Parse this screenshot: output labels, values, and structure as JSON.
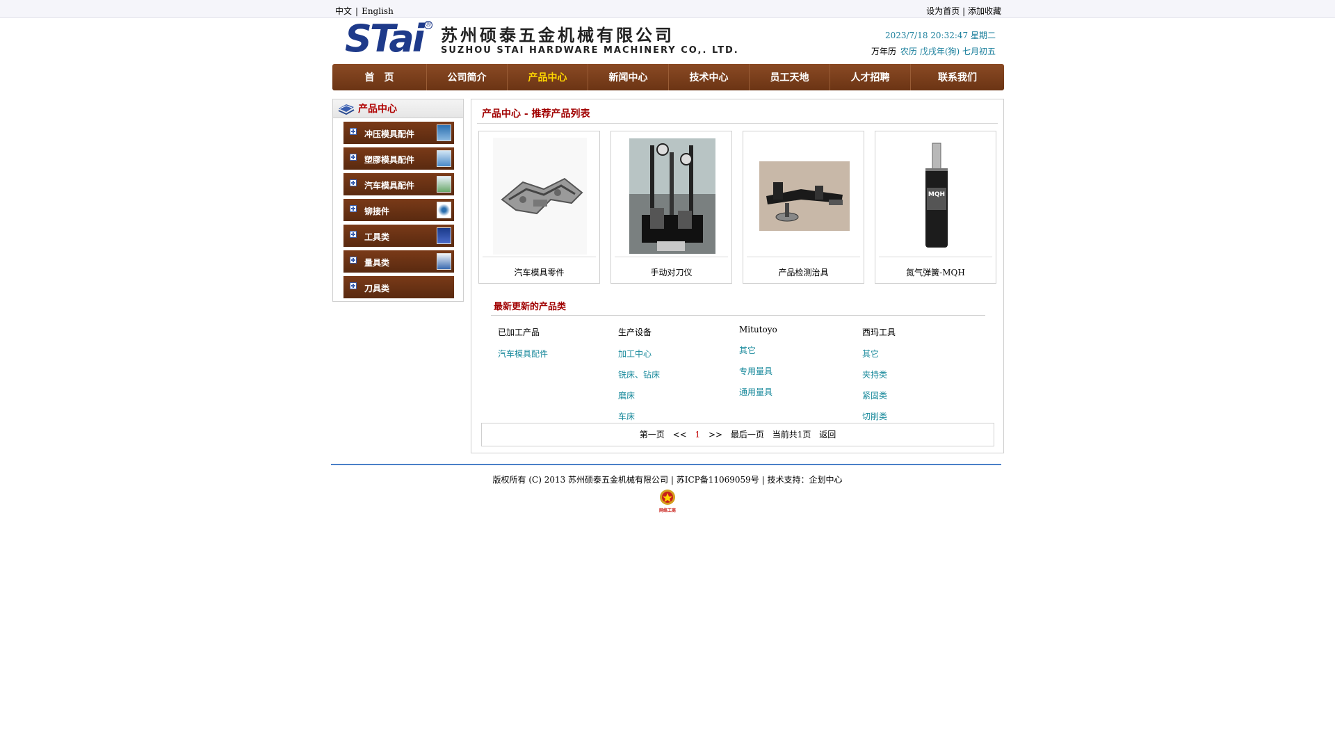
{
  "topbar": {
    "lang_cn": "中文",
    "lang_sep": "|",
    "lang_en": "English",
    "set_home": "设为首页",
    "link_sep": "|",
    "add_fav": "添加收藏"
  },
  "header": {
    "logo_mark": "STai",
    "logo_reg": "®",
    "company_cn": "苏州硕泰五金机械有限公司",
    "company_en": "SUZHOU STAI HARDWARE MACHINERY CO,. LTD.",
    "datetime": "2023/7/18 20:32:47 星期二",
    "calendar_label": "万年历",
    "lunar": "农历 戊戌年(狗) 七月初五"
  },
  "nav": {
    "items": [
      {
        "label": "首　页"
      },
      {
        "label": "公司简介"
      },
      {
        "label": "产品中心"
      },
      {
        "label": "新闻中心"
      },
      {
        "label": "技术中心"
      },
      {
        "label": "员工天地"
      },
      {
        "label": "人才招聘"
      },
      {
        "label": "联系我们"
      }
    ],
    "active_index": 2
  },
  "sidebar": {
    "title": "产品中心",
    "items": [
      {
        "label": "冲压模具配件"
      },
      {
        "label": "塑膠模具配件"
      },
      {
        "label": "汽车模具配件"
      },
      {
        "label": "铆接件"
      },
      {
        "label": "工具类"
      },
      {
        "label": "量具类"
      },
      {
        "label": "刀具类"
      }
    ]
  },
  "main": {
    "title": "产品中心 - 推荐产品列表",
    "products": [
      {
        "name": "汽车模具零件"
      },
      {
        "name": "手动对刀仪"
      },
      {
        "name": "产品检测治具"
      },
      {
        "name": "氮气弹簧-MQH"
      }
    ],
    "product_label_mqh": "MQH",
    "latest_title": "最新更新的产品类",
    "columns": [
      {
        "head": "已加工产品",
        "links": [
          "汽车模具配件"
        ]
      },
      {
        "head": "生产设备",
        "links": [
          "加工中心",
          "铣床、钻床",
          "磨床",
          "车床"
        ]
      },
      {
        "head": "Mitutoyo",
        "links": [
          "其它",
          "专用量具",
          "通用量具"
        ]
      },
      {
        "head": "西玛工具",
        "links": [
          "其它",
          "夹持类",
          "紧固类",
          "切削类"
        ]
      }
    ],
    "pager": {
      "first": "第一页",
      "prev": "<<",
      "current": "1",
      "next": ">>",
      "last": "最后一页",
      "total": "当前共1页",
      "back": "返回"
    }
  },
  "footer": {
    "copyright": "版权所有 (C) 2013 苏州硕泰五金机械有限公司 | 苏ICP备11069059号 | 技术支持：企划中心",
    "badge_text": "网络工商"
  },
  "colors": {
    "nav_brown": "#6b3414",
    "nav_active": "#ffd700",
    "accent_red": "#a00000",
    "link_teal": "#1a8a9c",
    "footer_blue": "#4a80c8",
    "logo_blue": "#1e3a8a"
  }
}
